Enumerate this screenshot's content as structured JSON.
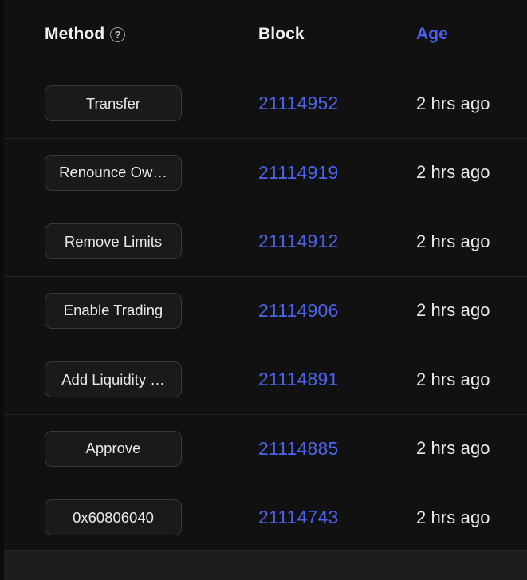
{
  "theme": {
    "page_background": "#111111",
    "row_divider": "#212325",
    "badge_background": "#1a1a1c",
    "badge_border": "#39393b",
    "link_blue": "#4b63e8",
    "accent_blue": "#4b5ef5",
    "text_primary": "#e9e9e9",
    "footer_background": "#1b1c1e"
  },
  "table": {
    "columns": [
      {
        "key": "method",
        "label": "Method",
        "help_icon": "question-circle-icon",
        "help_glyph": "?",
        "sorted": false
      },
      {
        "key": "block",
        "label": "Block",
        "sorted": false
      },
      {
        "key": "age",
        "label": "Age",
        "sorted": true
      }
    ],
    "rows": [
      {
        "method": "Transfer",
        "block": "21114952",
        "age": "2 hrs ago"
      },
      {
        "method": "Renounce Ow…",
        "block": "21114919",
        "age": "2 hrs ago"
      },
      {
        "method": "Remove Limits",
        "block": "21114912",
        "age": "2 hrs ago"
      },
      {
        "method": "Enable Trading",
        "block": "21114906",
        "age": "2 hrs ago"
      },
      {
        "method": "Add Liquidity …",
        "block": "21114891",
        "age": "2 hrs ago"
      },
      {
        "method": "Approve",
        "block": "21114885",
        "age": "2 hrs ago"
      },
      {
        "method": "0x60806040",
        "block": "21114743",
        "age": "2 hrs ago"
      }
    ]
  }
}
